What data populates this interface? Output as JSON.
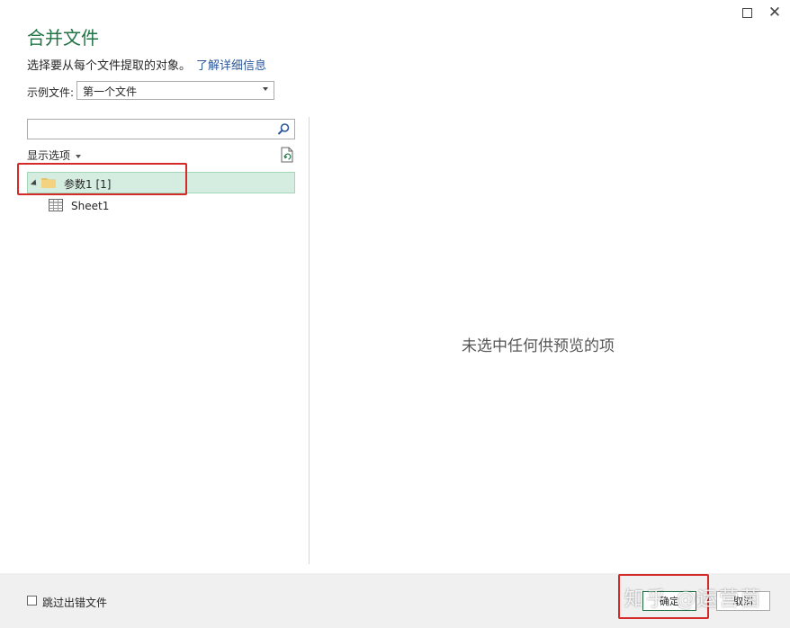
{
  "window": {
    "maximize_icon": "maximize-icon",
    "close_icon": "close-icon",
    "close_glyph": "✕"
  },
  "dialog": {
    "title": "合并文件",
    "description": "选择要从每个文件提取的对象。",
    "learn_more_link": "了解详细信息"
  },
  "sample_file": {
    "label": "示例文件:",
    "selected": "第一个文件"
  },
  "navigator": {
    "search_placeholder": "",
    "display_options_label": "显示选项",
    "tree": [
      {
        "label": "参数1 [1]",
        "icon": "folder-icon",
        "selected": true,
        "expanded": true
      },
      {
        "label": "Sheet1",
        "icon": "table-sheet-icon",
        "selected": false
      }
    ]
  },
  "preview": {
    "empty_message": "未选中任何供预览的项"
  },
  "footer": {
    "skip_errors_label": "跳过出错文件",
    "skip_errors_checked": false,
    "ok_label": "确定",
    "cancel_label": "取消"
  },
  "watermark": "知乎 @运营菌",
  "colors": {
    "accent": "#217346",
    "link": "#2b579a",
    "selection_bg": "#d4ede0",
    "highlight_red": "#d42a2a",
    "footer_bg": "#f0f0f0"
  }
}
